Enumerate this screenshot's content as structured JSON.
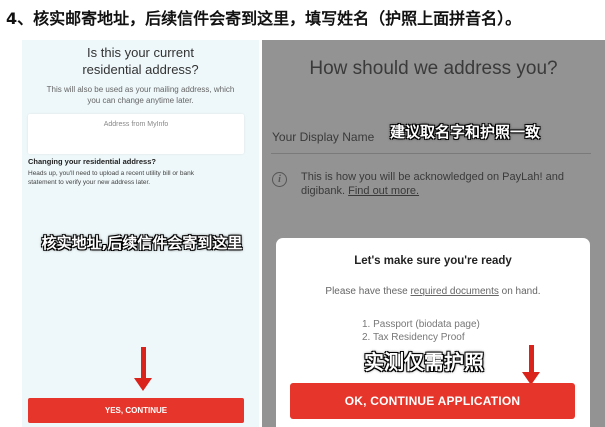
{
  "header": {
    "instruction": "4、核实邮寄地址，后续信件会寄到这里，填写姓名（护照上面拼音名）。"
  },
  "left_screen": {
    "title_line1": "Is this your current",
    "title_line2": "residential address?",
    "subtitle_line1": "This will also be used as your mailing address, which",
    "subtitle_line2": "you can change anytime later.",
    "address_box_label": "Address from MyInfo",
    "change_title": "Changing your residential address?",
    "change_text_line1": "Heads up, you'll need to upload a recent utility bill or bank",
    "change_text_line2": "statement to verify your new address later.",
    "annotation": "核实地址,后续信件会寄到这里",
    "button_label": "YES, CONTINUE"
  },
  "right_screen": {
    "title": "How should we address you?",
    "field_label": "Your Display Name",
    "field_annotation": "建议取名字和护照一致",
    "info_icon": "info-icon",
    "info_text": "This is how you will be acknowledged on PayLah! and digibank.",
    "info_link": "Find out more.",
    "sheet": {
      "title": "Let's make sure you're ready",
      "subtitle_prefix": "Please have these",
      "subtitle_link": "required documents",
      "subtitle_suffix": "on hand.",
      "items": [
        "1. Passport (biodata page)",
        "2. Tax Residency Proof"
      ],
      "annotation": "实测仅需护照",
      "button_label": "OK, CONTINUE APPLICATION"
    }
  },
  "colors": {
    "accent_red": "#e6362b",
    "arrow_red": "#d9231b",
    "left_bg": "#eef7f9",
    "right_overlay": "#939393"
  }
}
